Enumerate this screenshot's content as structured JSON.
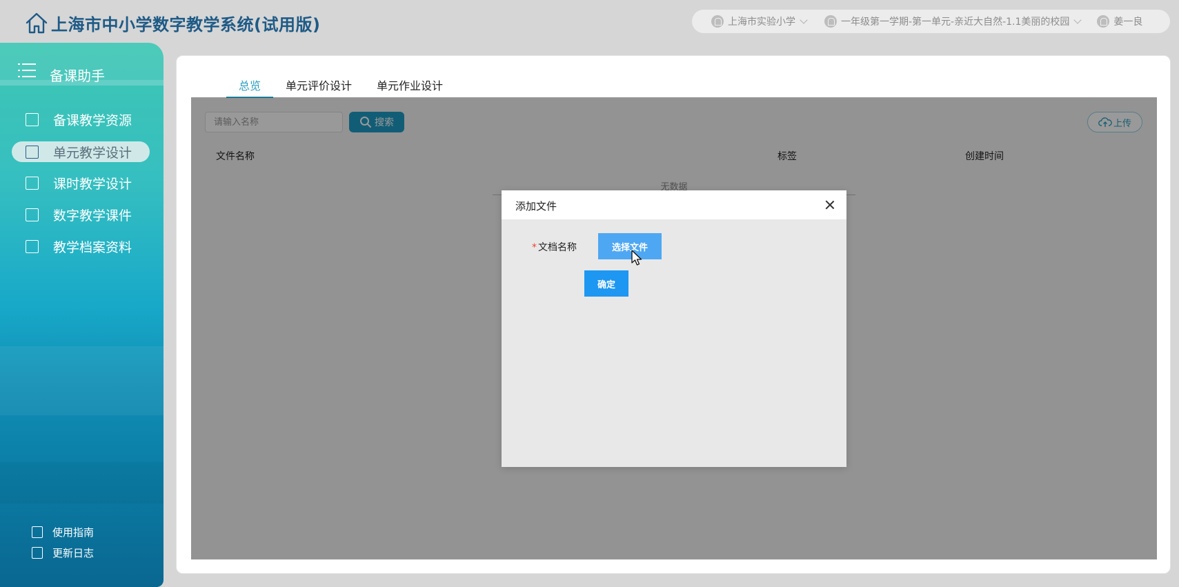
{
  "header": {
    "title": "上海市中小学数字教学系统(试用版)",
    "school": "上海市实验小学",
    "course": "一年级第一学期-第一单元-亲近大自然-1.1美丽的校园",
    "user": "姜一良"
  },
  "sidebar": {
    "title": "备课助手",
    "items": [
      {
        "label": "备课教学资源"
      },
      {
        "label": "单元教学设计"
      },
      {
        "label": "课时教学设计"
      },
      {
        "label": "数字教学课件"
      },
      {
        "label": "教学档案资料"
      }
    ],
    "footer": [
      {
        "label": "使用指南"
      },
      {
        "label": "更新日志"
      }
    ]
  },
  "main": {
    "tabs": [
      {
        "label": "总览"
      },
      {
        "label": "单元评价设计"
      },
      {
        "label": "单元作业设计"
      }
    ],
    "search_placeholder": "请输入名称",
    "search_label": "搜索",
    "upload_label": "上传",
    "table": {
      "columns": [
        "文件名称",
        "标签",
        "创建时间"
      ],
      "empty_text": "无数据"
    }
  },
  "modal": {
    "title": "添加文件",
    "field_label": "文档名称",
    "required_mark": "*",
    "choose_label": "选择文件",
    "confirm_label": "确定"
  }
}
